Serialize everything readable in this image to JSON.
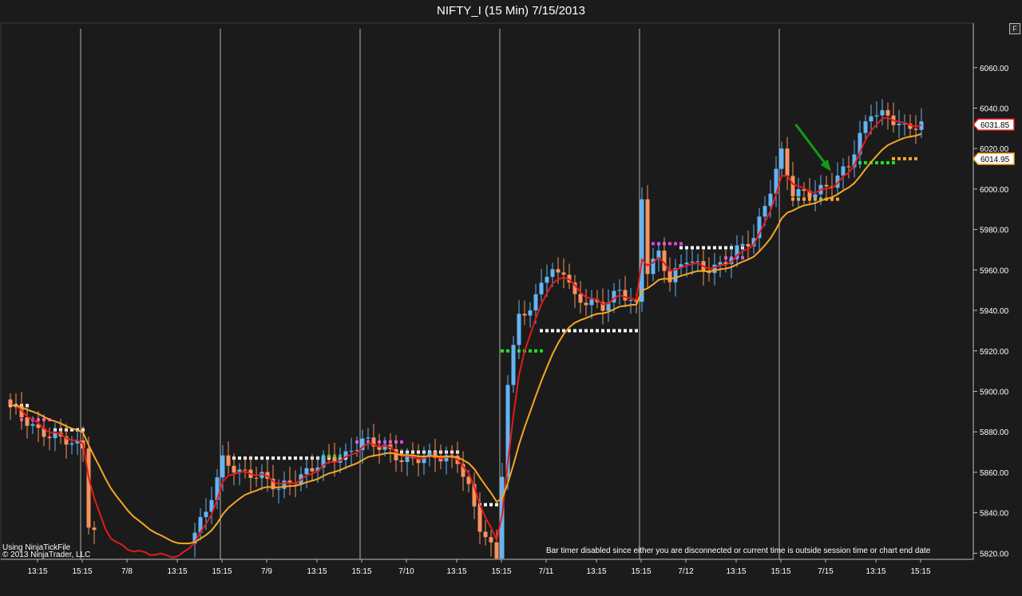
{
  "title": "NIFTY_I (15 Min)  7/15/2013",
  "panel_button": "F",
  "watermark": {
    "line1": "Using NinjaTickFile",
    "line2": "© 2013 NinjaTrader, LLC"
  },
  "bar_timer_note": "Bar timer disabled since either you are disconnected or current time is outside session time or chart end date",
  "colors": {
    "background": "#1b1b1b",
    "up_candle": "#64b4f5",
    "down_candle": "#f7935f",
    "fast_ma": "#e51a1a",
    "slow_ma": "#f5a623",
    "session_line": "#d8d8d8",
    "arrow": "#149a14"
  },
  "chart_data": {
    "type": "candlestick",
    "ylim": [
      5817,
      6082
    ],
    "y_ticks": [
      5820,
      5840,
      5860,
      5880,
      5900,
      5920,
      5940,
      5960,
      5980,
      6000,
      6020,
      6040,
      6060
    ],
    "x_ticks": [
      {
        "label": "13:15",
        "bar": 2
      },
      {
        "label": "15:15",
        "bar": 10
      },
      {
        "label": "7/8",
        "bar": 18
      },
      {
        "label": "13:15",
        "bar": 27
      },
      {
        "label": "15:15",
        "bar": 35
      },
      {
        "label": "7/9",
        "bar": 43
      },
      {
        "label": "13:15",
        "bar": 52
      },
      {
        "label": "15:15",
        "bar": 60
      },
      {
        "label": "7/10",
        "bar": 68
      },
      {
        "label": "13:15",
        "bar": 77
      },
      {
        "label": "15:15",
        "bar": 85
      },
      {
        "label": "7/11",
        "bar": 93
      },
      {
        "label": "13:15",
        "bar": 102
      },
      {
        "label": "15:15",
        "bar": 110
      },
      {
        "label": "7/12",
        "bar": 118
      },
      {
        "label": "13:15",
        "bar": 127
      },
      {
        "label": "15:15",
        "bar": 135
      },
      {
        "label": "7/15",
        "bar": 143
      },
      {
        "label": "13:15",
        "bar": 152
      },
      {
        "label": "15:15",
        "bar": 160
      }
    ],
    "session_breaks": [
      13,
      38,
      63,
      88,
      113,
      138
    ],
    "price_markers": [
      {
        "label": "6031.85",
        "value": 6031.85,
        "color": "#e51a1a"
      },
      {
        "label": "6014.95",
        "value": 6014.95,
        "color": "#f5a623"
      }
    ],
    "arrow": {
      "from_bar": 140.5,
      "from_value": 6032,
      "to_bar": 146.5,
      "to_value": 6010
    }
  }
}
